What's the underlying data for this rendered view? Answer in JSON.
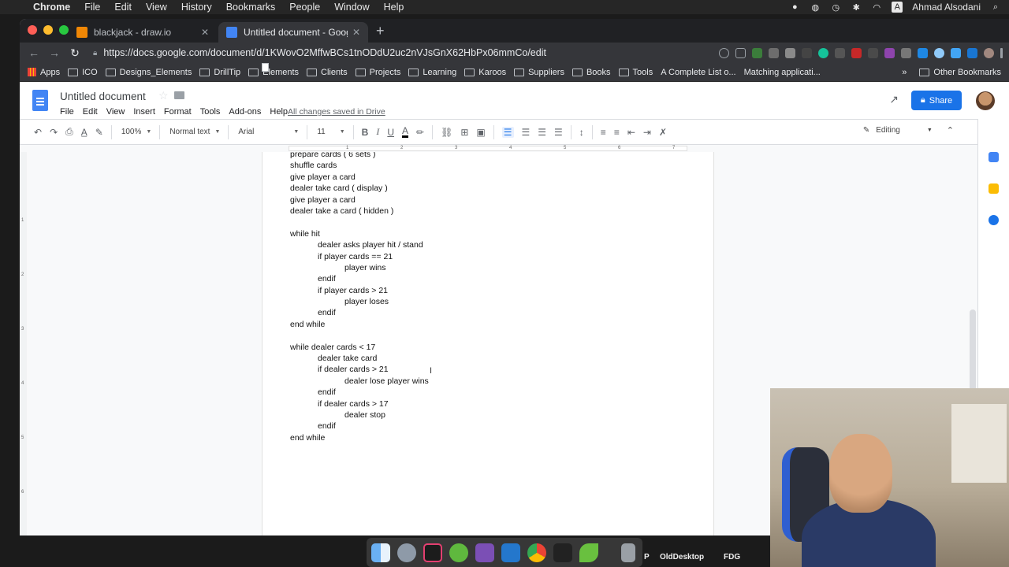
{
  "mac_menubar": {
    "app": "Chrome",
    "items": [
      "File",
      "Edit",
      "View",
      "History",
      "Bookmarks",
      "People",
      "Window",
      "Help"
    ],
    "user": "Ahmad Alsodani"
  },
  "tabs": [
    {
      "title": "blackjack - draw.io",
      "color": "#f08705"
    },
    {
      "title": "Untitled document - Google Do",
      "color": "#4285f4"
    }
  ],
  "address_bar": {
    "url": "https://docs.google.com/document/d/1KWovO2MffwBCs1tnODdU2uc2nVJsGnX62HbPx06mmCo/edit"
  },
  "bookmarks": {
    "apps": "Apps",
    "items": [
      "ICO",
      "Designs_Elements",
      "DrillTip",
      "Elements",
      "Clients",
      "Projects",
      "Learning",
      "Karoos",
      "Suppliers",
      "Books",
      "Tools"
    ],
    "pages": [
      "A Complete List o...",
      "Matching applicati..."
    ],
    "more": "»",
    "other": "Other Bookmarks"
  },
  "docs": {
    "title": "Untitled document",
    "menu": [
      "File",
      "Edit",
      "View",
      "Insert",
      "Format",
      "Tools",
      "Add-ons",
      "Help"
    ],
    "saved_status": "All changes saved in Drive",
    "share": "Share"
  },
  "format_bar": {
    "zoom": "100%",
    "style": "Normal text",
    "font": "Arial",
    "size": "11",
    "mode": "Editing"
  },
  "ruler": {
    "marks": [
      "1",
      "2",
      "3",
      "4",
      "5",
      "6",
      "7"
    ],
    "vmarks": [
      "1",
      "2",
      "3",
      "4",
      "5",
      "6",
      "7"
    ]
  },
  "document_lines": [
    {
      "indent": 0,
      "text": "prepare cards ( 6 sets )"
    },
    {
      "indent": 0,
      "text": "shuffle cards"
    },
    {
      "indent": 0,
      "text": "give player a card"
    },
    {
      "indent": 0,
      "text": "dealer take card ( display )"
    },
    {
      "indent": 0,
      "text": "give player a card"
    },
    {
      "indent": 0,
      "text": "dealer take a card ( hidden )"
    },
    {
      "indent": 0,
      "text": ""
    },
    {
      "indent": 0,
      "text": "while hit"
    },
    {
      "indent": 1,
      "text": "dealer asks player hit / stand"
    },
    {
      "indent": 1,
      "text": "if player cards == 21"
    },
    {
      "indent": 2,
      "text": "player wins"
    },
    {
      "indent": 1,
      "text": "endif"
    },
    {
      "indent": 1,
      "text": "if player cards > 21"
    },
    {
      "indent": 2,
      "text": "player loses"
    },
    {
      "indent": 1,
      "text": "endif"
    },
    {
      "indent": 0,
      "text": "end while"
    },
    {
      "indent": 0,
      "text": ""
    },
    {
      "indent": 0,
      "text": "while dealer cards < 17"
    },
    {
      "indent": 1,
      "text": "dealer take card"
    },
    {
      "indent": 1,
      "text": "if dealer cards > 21"
    },
    {
      "indent": 2,
      "text": "dealer lose player wins"
    },
    {
      "indent": 1,
      "text": "endif"
    },
    {
      "indent": 1,
      "text": "if dealer cards > 17"
    },
    {
      "indent": 2,
      "text": "dealer stop"
    },
    {
      "indent": 1,
      "text": "endif"
    },
    {
      "indent": 0,
      "text": "end while"
    }
  ],
  "dock_labels": {
    "p": "P",
    "old_desktop": "OldDesktop",
    "fdg": "FDG"
  },
  "colors": {
    "accent": "#1a73e8",
    "docs_blue": "#4285f4"
  }
}
